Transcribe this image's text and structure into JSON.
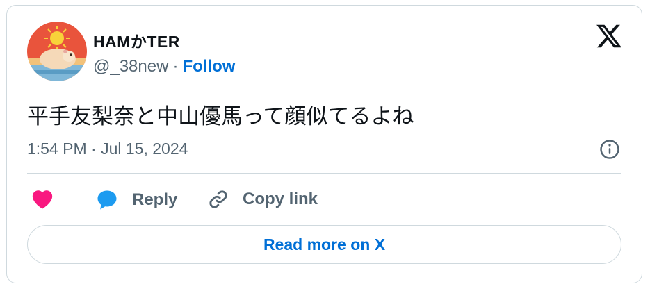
{
  "author": {
    "display_name": "HAMかTER",
    "handle": "@_38new",
    "separator": "·",
    "follow_label": "Follow"
  },
  "tweet": {
    "text": "平手友梨奈と中山優馬って顔似てるよね",
    "timestamp": "1:54 PM · Jul 15, 2024"
  },
  "actions": {
    "reply_label": "Reply",
    "copy_label": "Copy link"
  },
  "footer": {
    "read_more_label": "Read more on X"
  },
  "colors": {
    "like": "#f91880",
    "reply": "#1d9bf0",
    "link": "#006fd6",
    "muted": "#536471",
    "border": "#cfd9de"
  },
  "icons": [
    "x-logo-icon",
    "info-icon",
    "heart-icon",
    "reply-bubble-icon",
    "link-icon"
  ]
}
